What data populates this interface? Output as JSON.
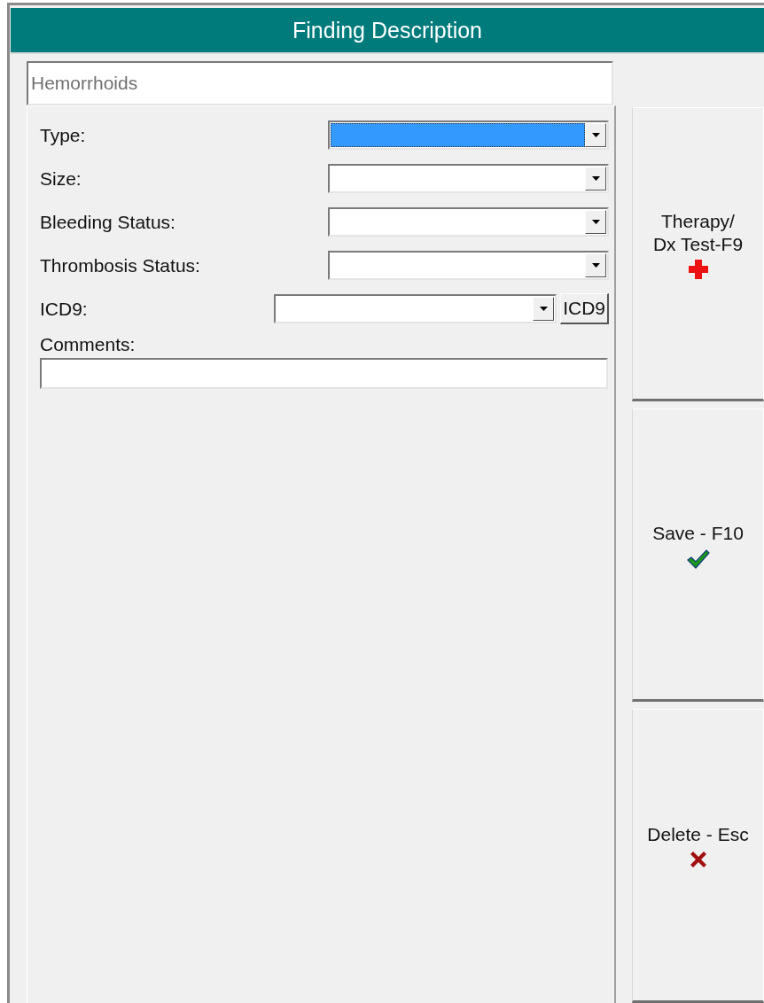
{
  "window": {
    "title": "Finding Description"
  },
  "finding": {
    "value": "Hemorrhoids"
  },
  "fields": [
    {
      "kind": "combo",
      "label": "Type:",
      "highlighted": true
    },
    {
      "kind": "combo",
      "label": "Size:",
      "highlighted": false
    },
    {
      "kind": "combo",
      "label": "Bleeding Status:",
      "highlighted": false
    },
    {
      "kind": "combo",
      "label": "Thrombosis Status:",
      "highlighted": false
    },
    {
      "kind": "combo_button",
      "label": "ICD9:",
      "highlighted": false,
      "button": "ICD9"
    },
    {
      "kind": "text",
      "label": "Comments:"
    }
  ],
  "buttons": [
    {
      "kind": "therapy",
      "label": "Therapy/\nDx Test-F9"
    },
    {
      "kind": "save",
      "label": "Save - F10"
    },
    {
      "kind": "delete",
      "label": "Delete - Esc"
    }
  ]
}
